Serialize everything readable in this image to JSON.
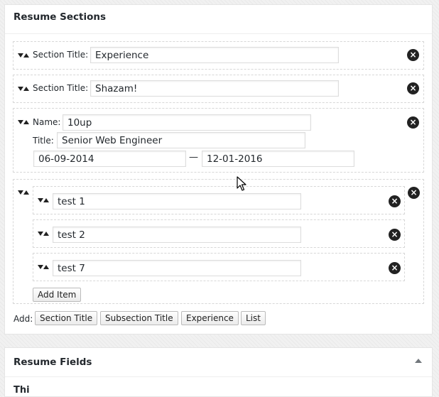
{
  "resume_sections": {
    "title": "Resume Sections",
    "sections": [
      {
        "label": "Section Title:",
        "value": "Experience",
        "remove": "×"
      },
      {
        "label": "Section Title:",
        "value": "Shazam!",
        "remove": "×"
      }
    ],
    "experience": {
      "name_label": "Name:",
      "name_value": "10up",
      "title_label": "Title:",
      "title_value": "Senior Web Engineer",
      "start_date": "06-09-2014",
      "separator": "—",
      "end_date": "12-01-2016",
      "remove": "×"
    },
    "list": {
      "items": [
        {
          "value": "test 1",
          "remove": "×"
        },
        {
          "value": "test 2",
          "remove": "×"
        },
        {
          "value": "test 7",
          "remove": "×"
        }
      ],
      "add_item_label": "Add Item",
      "remove": "×"
    },
    "add": {
      "label": "Add:",
      "buttons": [
        "Section Title",
        "Subsection Title",
        "Experience",
        "List"
      ]
    }
  },
  "resume_fields": {
    "title": "Resume Fields",
    "partial_text": "Thi"
  },
  "icons": {
    "toggle": "triangle-up-icon",
    "handle": "sort-handle-icon",
    "remove": "remove-circle-icon",
    "cursor": "mouse-pointer-icon"
  }
}
